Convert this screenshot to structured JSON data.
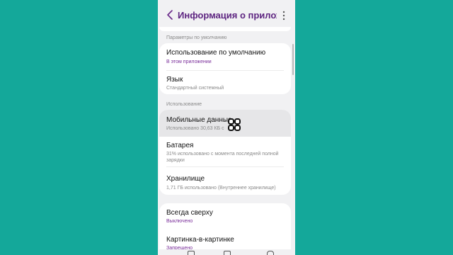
{
  "appbar": {
    "title": "Информация о прилож...",
    "back_icon": "chevron-left-icon",
    "more_icon": "more-vertical-icon"
  },
  "sections": {
    "defaults": "Параметры по умолчанию",
    "usage": "Использование"
  },
  "defaults_card": {
    "default_use": {
      "label": "Использование по умолчанию",
      "value": "В этом приложении"
    },
    "language": {
      "label": "Язык",
      "value": "Стандартный системный"
    }
  },
  "usage_card": {
    "mobile_data": {
      "label": "Мобильные данные",
      "value": "Использовано 30,63 КБ с"
    },
    "battery": {
      "label": "Батарея",
      "value_line1": "31% использовано с момента последней полной",
      "value_line2": "зарядки"
    },
    "storage": {
      "label": "Хранилище",
      "value": "1,71 ГБ использовано (Внутреннее хранилище)"
    }
  },
  "permissions_card": {
    "always_on_top": {
      "label": "Всегда сверху",
      "value": "Выключено"
    },
    "pip": {
      "label": "Картинка-в-картинке",
      "value": "Запрещено"
    }
  },
  "overlay_icon": "grid-four-rounded-icon",
  "colors": {
    "background": "#14a89a",
    "accent": "#7a2e9a",
    "title": "#5d2480"
  }
}
